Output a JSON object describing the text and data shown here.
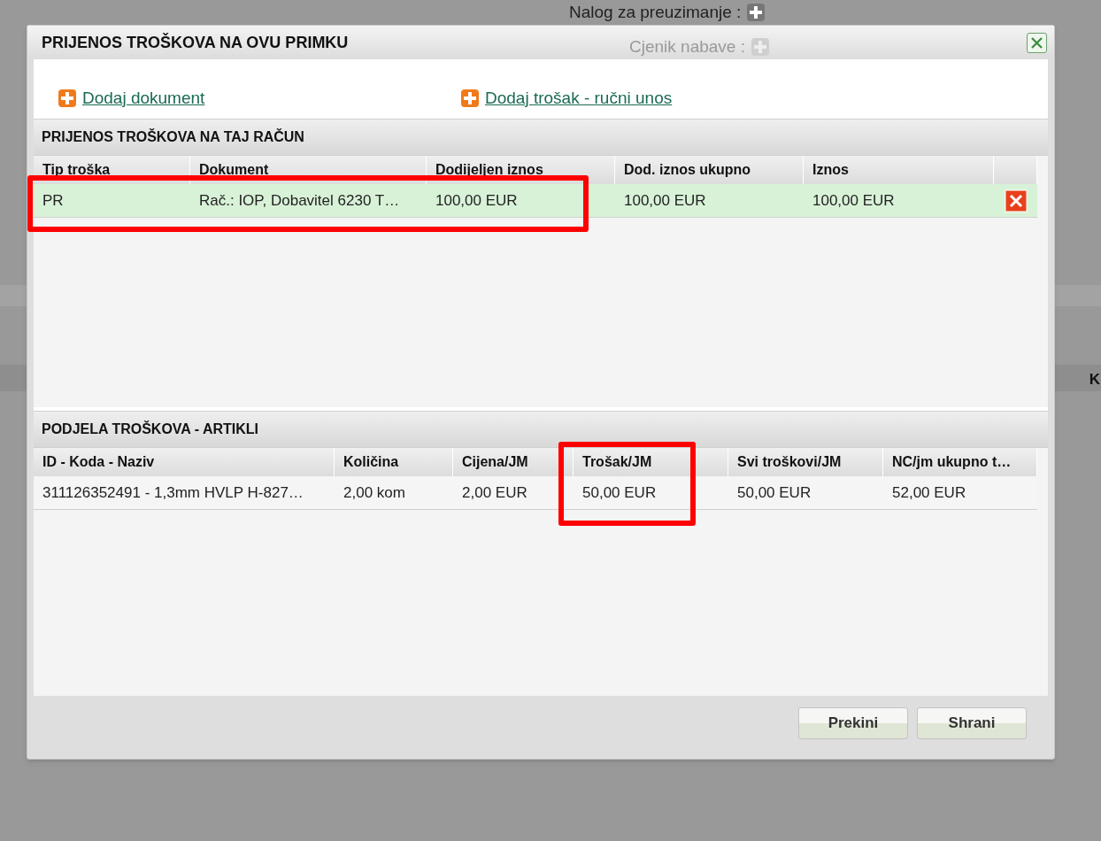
{
  "background": {
    "labels": [
      "Nalog za preuzimanje :",
      "Cjenik nabave :"
    ],
    "column_header": "K"
  },
  "dialog": {
    "title": "PRIJENOS TROŠKOVA NA OVU PRIMKU",
    "links": [
      "Dodaj dokument",
      "Dodaj trošak - ručni unos"
    ],
    "cost_table": {
      "title": "PRIJENOS TROŠKOVA NA TAJ RAČUN",
      "columns": [
        {
          "label": "Tip troška"
        },
        {
          "label": "Dokument"
        },
        {
          "label": "Dodijeljen iznos"
        },
        {
          "label": "Dod. iznos ukupno"
        },
        {
          "label": "Iznos"
        }
      ],
      "rows": [
        {
          "cells": [
            "PR",
            "Rač.: IOP, Dobavitel 6230 T…",
            "100,00 EUR",
            "100,00 EUR",
            "100,00 EUR"
          ],
          "selected": true
        }
      ]
    },
    "items_table": {
      "title": "PODJELA TROŠKOVA - ARTIKLI",
      "columns": [
        {
          "label": "ID - Koda - Naziv"
        },
        {
          "label": "Količina"
        },
        {
          "label": "Cijena/JM"
        },
        {
          "label": "Trošak/JM"
        },
        {
          "label": "Svi troškovi/JM"
        },
        {
          "label": "NC/jm ukupno t…"
        }
      ],
      "rows": [
        {
          "cells": [
            "311126352491 - 1,3mm HVLP H-827…",
            "2,00 kom",
            "2,00 EUR",
            "50,00 EUR",
            "50,00 EUR",
            "52,00 EUR"
          ],
          "selected": false
        }
      ]
    },
    "buttons": [
      "Prekini",
      "Shrani"
    ]
  },
  "annotations": [
    {
      "kind": "frame"
    },
    {
      "kind": "frame"
    }
  ]
}
